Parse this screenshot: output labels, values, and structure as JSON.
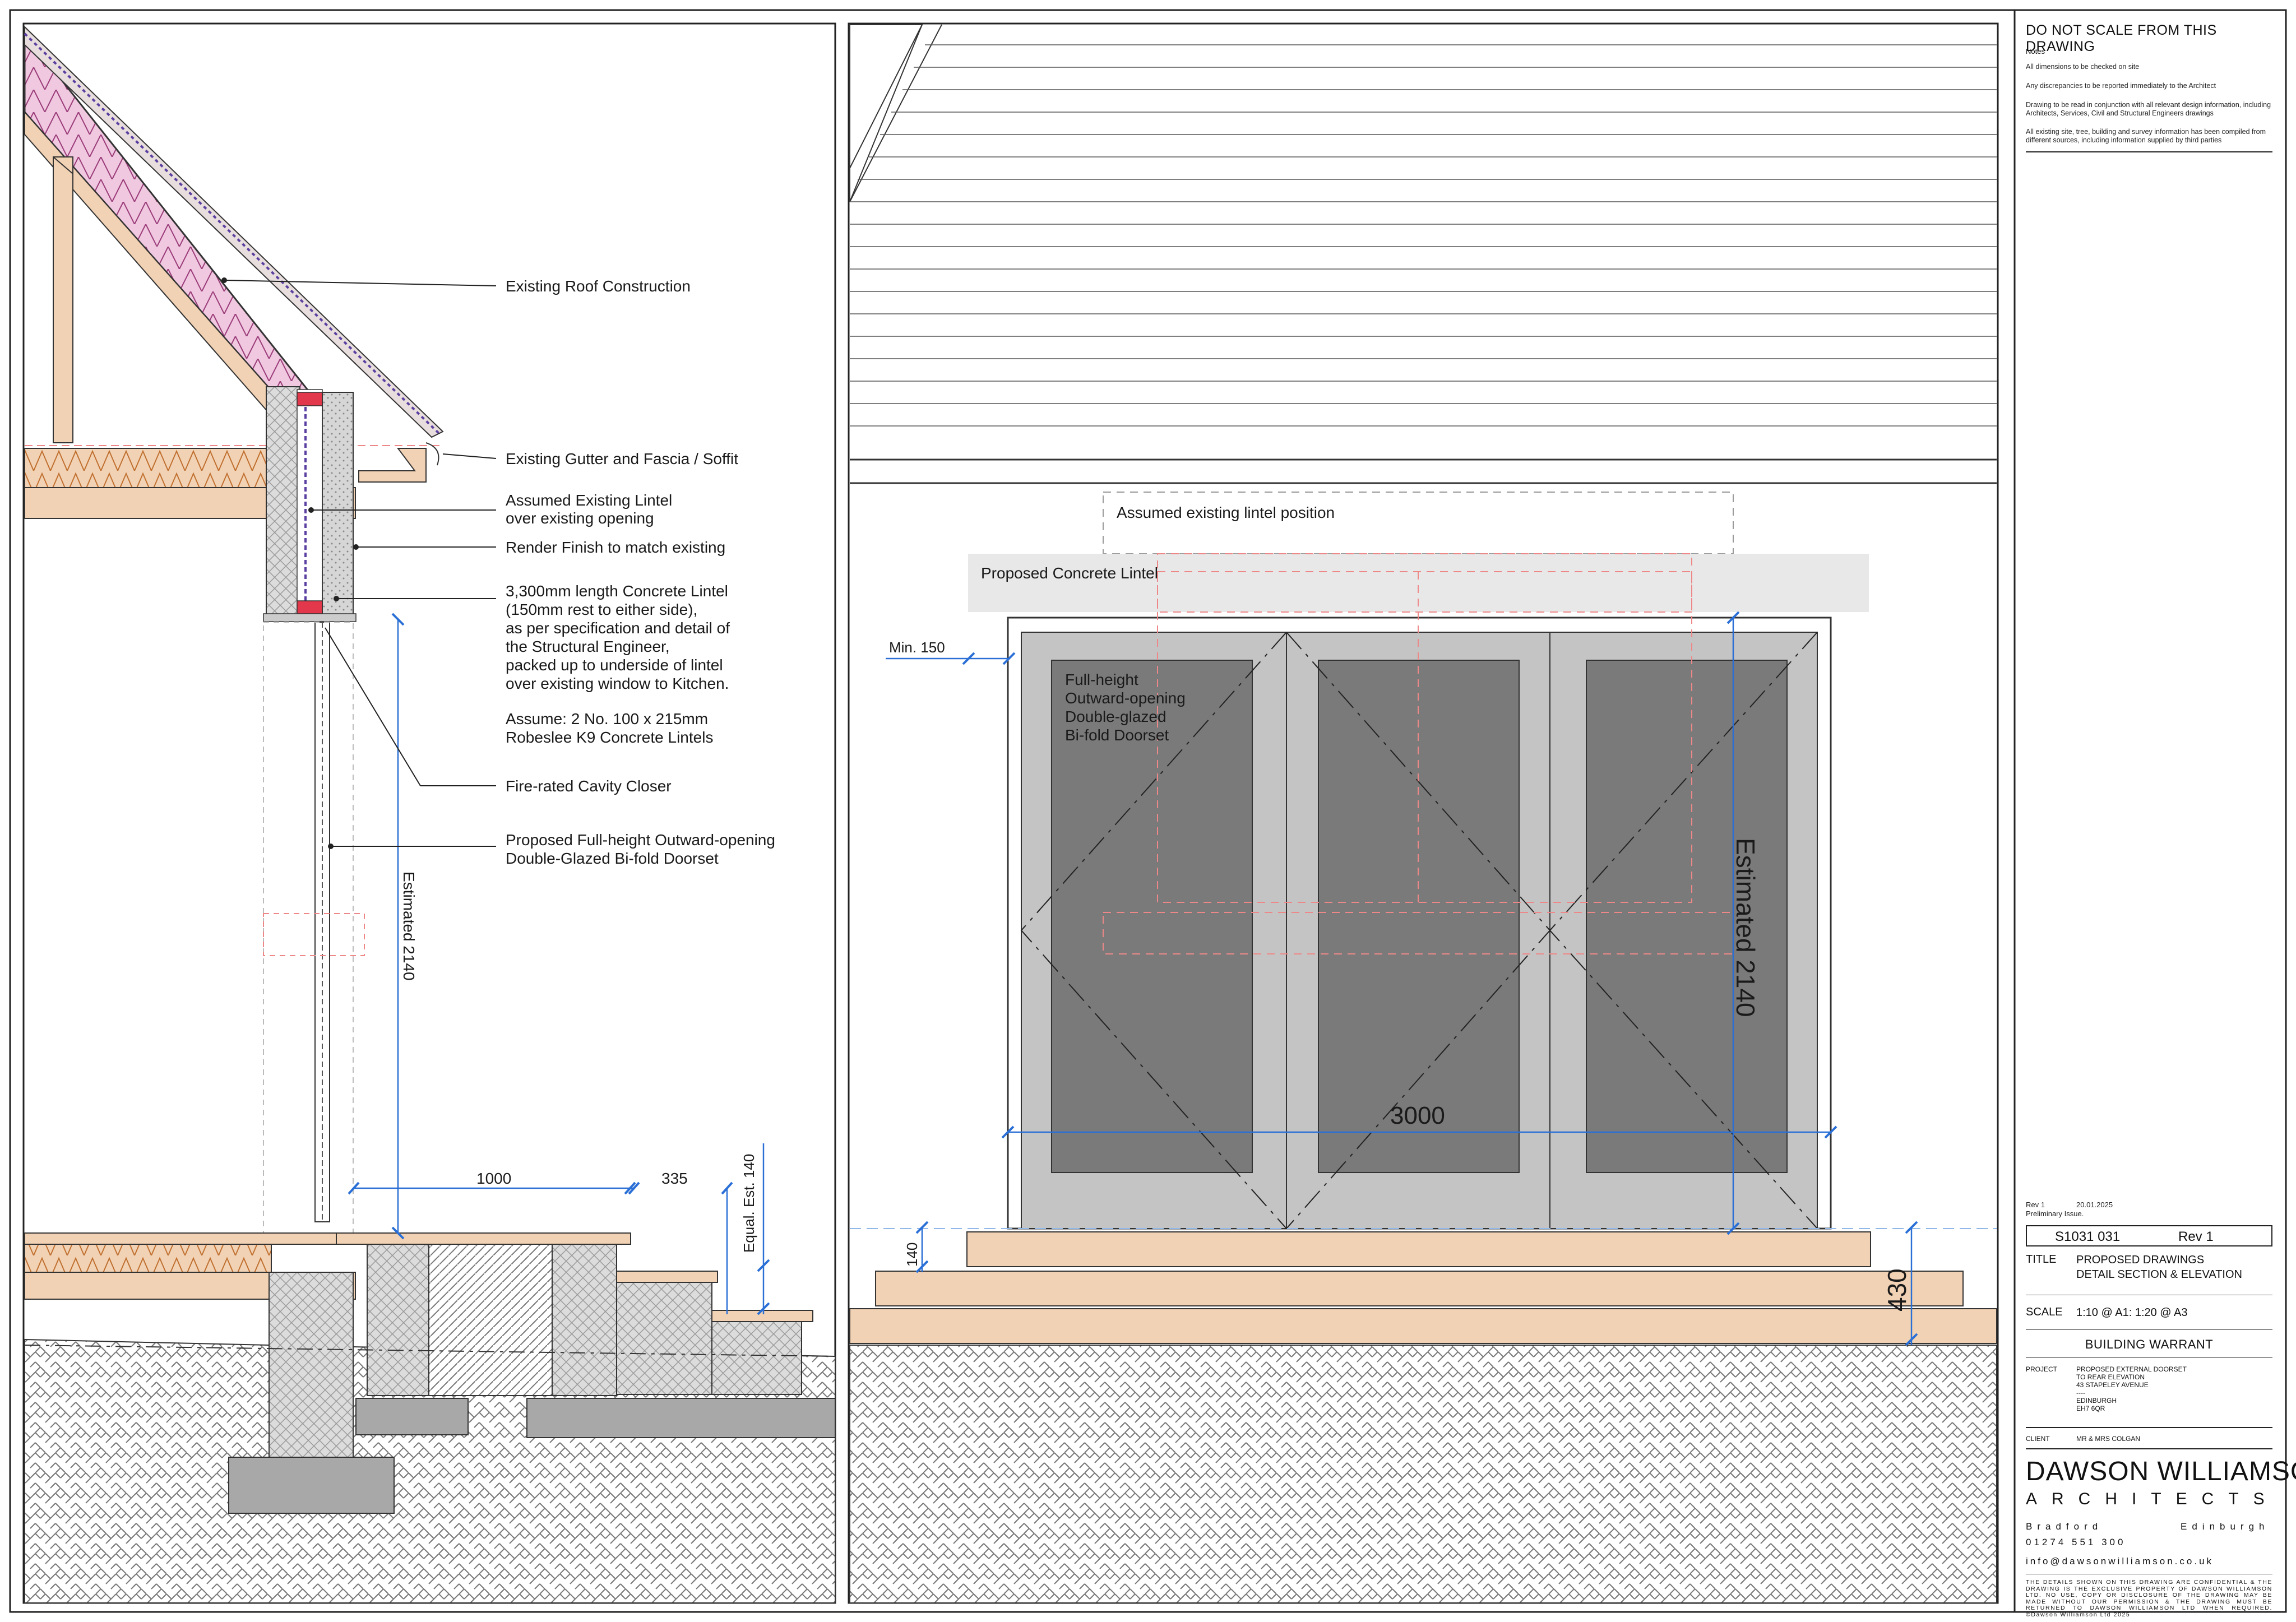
{
  "section_annotations": {
    "roof": "Existing Roof Construction",
    "gutter": "Existing Gutter and Fascia / Soffit",
    "lintel_existing_1": "Assumed Existing Lintel",
    "lintel_existing_2": "over existing opening",
    "render": "Render Finish to match existing",
    "concrete_lintel_1": "3,300mm length Concrete Lintel",
    "concrete_lintel_2": "(150mm rest to either side),",
    "concrete_lintel_3": "as per specification and detail of",
    "concrete_lintel_4": "the Structural Engineer,",
    "concrete_lintel_5": "packed up to underside of lintel",
    "concrete_lintel_6": "over existing window to Kitchen.",
    "assume_1": "Assume: 2 No. 100 x 215mm",
    "assume_2": "Robeslee K9 Concrete Lintels",
    "cavity_closer": "Fire-rated Cavity Closer",
    "doorset_1": "Proposed Full-height Outward-opening",
    "doorset_2": "Double-Glazed Bi-fold Doorset"
  },
  "section_dimensions": {
    "height": "Estimated 2140",
    "step_1": "1000",
    "step_2": "335",
    "step_rise": "Equal. Est. 140"
  },
  "elevation_annotations": {
    "existing_lintel": "Assumed existing lintel position",
    "proposed_lintel": "Proposed Concrete Lintel",
    "min_150": "Min. 150",
    "door_1": "Full-height",
    "door_2": "Outward-opening",
    "door_3": "Double-glazed",
    "door_4": "Bi-fold Doorset"
  },
  "elevation_dimensions": {
    "height": "Estimated 2140",
    "width": "3000",
    "step": "140",
    "total_rise": "430"
  },
  "title_block": {
    "do_not_scale": "DO NOT SCALE FROM THIS DRAWING",
    "notes_heading": "Notes",
    "notes": [
      "All dimensions to be checked on site",
      "Any discrepancies to be reported immediately to the Architect",
      "Drawing to be read in conjunction with all relevant design information, including Architects, Services, Civil and Structural Engineers drawings",
      "All existing site, tree, building and survey information has been compiled from different sources, including information supplied by third parties"
    ],
    "rev_label": "Rev 1",
    "rev_date": "20.01.2025",
    "rev_note": "Preliminary Issue.",
    "drawing_number": "S1031 031",
    "drawing_rev": "Rev 1",
    "title_label": "TITLE",
    "title_1": "PROPOSED DRAWINGS",
    "title_2": "DETAIL SECTION & ELEVATION",
    "scale_label": "SCALE",
    "scale_value": "1:10 @ A1: 1:20 @ A3",
    "status": "BUILDING WARRANT",
    "project_label": "PROJECT",
    "project_value": "PROPOSED EXTERNAL DOORSET\nTO REAR ELEVATION\n43 STAPELEY AVENUE\n----\nEDINBURGH\nEH7 6QR",
    "client_label": "CLIENT",
    "client_value": "MR & MRS COLGAN",
    "brand_1": "DAWSON WILLIAMSON",
    "brand_2": "ARCHITECTS",
    "office_1": "Bradford",
    "office_2": "Edinburgh",
    "phone": "01274 551 300",
    "email": "info@dawsonwilliamson.co.uk",
    "confidential": "THE DETAILS SHOWN ON THIS DRAWING ARE CONFIDENTIAL & THE DRAWING IS THE EXCLUSIVE PROPERTY OF DAWSON WILLIAMSON LTD. NO USE, COPY OR DISCLOSURE OF THE DRAWING MAY BE MADE WITHOUT OUR PERMISSION & THE DRAWING MUST BE RETURNED TO DAWSON WILLIAMSON LTD WHEN REQUIRED. ©Dawson Williamson Ltd 2025"
  },
  "colors": {
    "insulation": "#f0c8e0",
    "timber": "#f2d2b4",
    "concrete": "#cccccc",
    "glass": "#7a7a7a",
    "frame": "#c4c4c4",
    "dimension": "#2a6fd6",
    "lintel": "#e3374b"
  }
}
